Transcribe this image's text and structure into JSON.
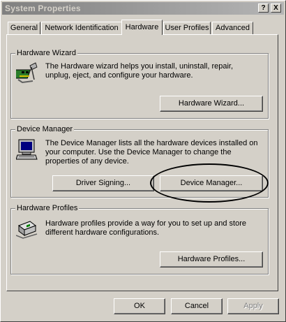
{
  "window": {
    "title": "System Properties",
    "help_label": "?",
    "close_label": "X"
  },
  "tabs": [
    {
      "label": "General"
    },
    {
      "label": "Network Identification"
    },
    {
      "label": "Hardware"
    },
    {
      "label": "User Profiles"
    },
    {
      "label": "Advanced"
    }
  ],
  "active_tab": "Hardware",
  "groups": {
    "hardware_wizard": {
      "label": "Hardware Wizard",
      "description": "The Hardware wizard helps you install, uninstall, repair, unplug, eject, and configure your hardware.",
      "button": "Hardware Wizard..."
    },
    "device_manager": {
      "label": "Device Manager",
      "description": "The Device Manager lists all the hardware devices installed on your computer. Use the Device Manager to change the properties of any device.",
      "button_signing": "Driver Signing...",
      "button_manager": "Device Manager..."
    },
    "hardware_profiles": {
      "label": "Hardware Profiles",
      "description": "Hardware profiles provide a way for you to set up and store different hardware configurations.",
      "button": "Hardware Profiles..."
    }
  },
  "footer": {
    "ok": "OK",
    "cancel": "Cancel",
    "apply": "Apply"
  },
  "colors": {
    "face": "#d4d0c8",
    "title_start": "#808080",
    "title_end": "#b5b5b5",
    "highlight": "#ffffff",
    "shadow": "#404040"
  },
  "icons": [
    "hardware-wizard-icon",
    "device-manager-icon",
    "hardware-profiles-icon"
  ]
}
